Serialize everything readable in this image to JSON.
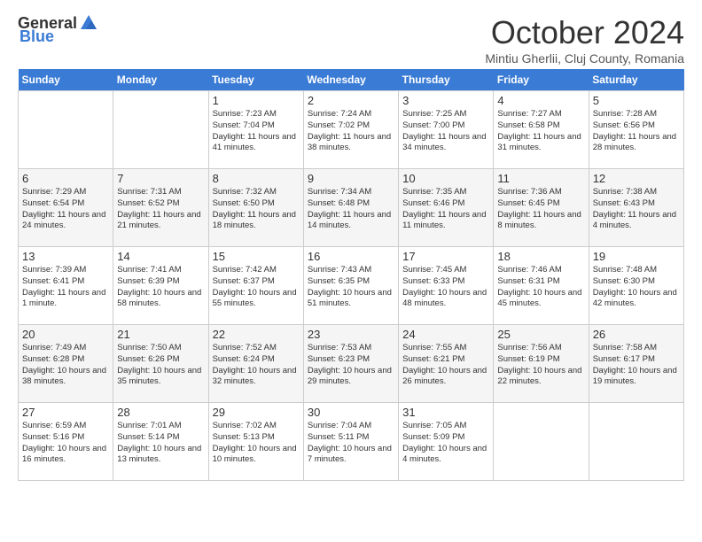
{
  "header": {
    "logo_general": "General",
    "logo_blue": "Blue",
    "month": "October 2024",
    "location": "Mintiu Gherlii, Cluj County, Romania"
  },
  "days_of_week": [
    "Sunday",
    "Monday",
    "Tuesday",
    "Wednesday",
    "Thursday",
    "Friday",
    "Saturday"
  ],
  "weeks": [
    [
      {
        "day": "",
        "info": ""
      },
      {
        "day": "",
        "info": ""
      },
      {
        "day": "1",
        "info": "Sunrise: 7:23 AM\nSunset: 7:04 PM\nDaylight: 11 hours and 41 minutes."
      },
      {
        "day": "2",
        "info": "Sunrise: 7:24 AM\nSunset: 7:02 PM\nDaylight: 11 hours and 38 minutes."
      },
      {
        "day": "3",
        "info": "Sunrise: 7:25 AM\nSunset: 7:00 PM\nDaylight: 11 hours and 34 minutes."
      },
      {
        "day": "4",
        "info": "Sunrise: 7:27 AM\nSunset: 6:58 PM\nDaylight: 11 hours and 31 minutes."
      },
      {
        "day": "5",
        "info": "Sunrise: 7:28 AM\nSunset: 6:56 PM\nDaylight: 11 hours and 28 minutes."
      }
    ],
    [
      {
        "day": "6",
        "info": "Sunrise: 7:29 AM\nSunset: 6:54 PM\nDaylight: 11 hours and 24 minutes."
      },
      {
        "day": "7",
        "info": "Sunrise: 7:31 AM\nSunset: 6:52 PM\nDaylight: 11 hours and 21 minutes."
      },
      {
        "day": "8",
        "info": "Sunrise: 7:32 AM\nSunset: 6:50 PM\nDaylight: 11 hours and 18 minutes."
      },
      {
        "day": "9",
        "info": "Sunrise: 7:34 AM\nSunset: 6:48 PM\nDaylight: 11 hours and 14 minutes."
      },
      {
        "day": "10",
        "info": "Sunrise: 7:35 AM\nSunset: 6:46 PM\nDaylight: 11 hours and 11 minutes."
      },
      {
        "day": "11",
        "info": "Sunrise: 7:36 AM\nSunset: 6:45 PM\nDaylight: 11 hours and 8 minutes."
      },
      {
        "day": "12",
        "info": "Sunrise: 7:38 AM\nSunset: 6:43 PM\nDaylight: 11 hours and 4 minutes."
      }
    ],
    [
      {
        "day": "13",
        "info": "Sunrise: 7:39 AM\nSunset: 6:41 PM\nDaylight: 11 hours and 1 minute."
      },
      {
        "day": "14",
        "info": "Sunrise: 7:41 AM\nSunset: 6:39 PM\nDaylight: 10 hours and 58 minutes."
      },
      {
        "day": "15",
        "info": "Sunrise: 7:42 AM\nSunset: 6:37 PM\nDaylight: 10 hours and 55 minutes."
      },
      {
        "day": "16",
        "info": "Sunrise: 7:43 AM\nSunset: 6:35 PM\nDaylight: 10 hours and 51 minutes."
      },
      {
        "day": "17",
        "info": "Sunrise: 7:45 AM\nSunset: 6:33 PM\nDaylight: 10 hours and 48 minutes."
      },
      {
        "day": "18",
        "info": "Sunrise: 7:46 AM\nSunset: 6:31 PM\nDaylight: 10 hours and 45 minutes."
      },
      {
        "day": "19",
        "info": "Sunrise: 7:48 AM\nSunset: 6:30 PM\nDaylight: 10 hours and 42 minutes."
      }
    ],
    [
      {
        "day": "20",
        "info": "Sunrise: 7:49 AM\nSunset: 6:28 PM\nDaylight: 10 hours and 38 minutes."
      },
      {
        "day": "21",
        "info": "Sunrise: 7:50 AM\nSunset: 6:26 PM\nDaylight: 10 hours and 35 minutes."
      },
      {
        "day": "22",
        "info": "Sunrise: 7:52 AM\nSunset: 6:24 PM\nDaylight: 10 hours and 32 minutes."
      },
      {
        "day": "23",
        "info": "Sunrise: 7:53 AM\nSunset: 6:23 PM\nDaylight: 10 hours and 29 minutes."
      },
      {
        "day": "24",
        "info": "Sunrise: 7:55 AM\nSunset: 6:21 PM\nDaylight: 10 hours and 26 minutes."
      },
      {
        "day": "25",
        "info": "Sunrise: 7:56 AM\nSunset: 6:19 PM\nDaylight: 10 hours and 22 minutes."
      },
      {
        "day": "26",
        "info": "Sunrise: 7:58 AM\nSunset: 6:17 PM\nDaylight: 10 hours and 19 minutes."
      }
    ],
    [
      {
        "day": "27",
        "info": "Sunrise: 6:59 AM\nSunset: 5:16 PM\nDaylight: 10 hours and 16 minutes."
      },
      {
        "day": "28",
        "info": "Sunrise: 7:01 AM\nSunset: 5:14 PM\nDaylight: 10 hours and 13 minutes."
      },
      {
        "day": "29",
        "info": "Sunrise: 7:02 AM\nSunset: 5:13 PM\nDaylight: 10 hours and 10 minutes."
      },
      {
        "day": "30",
        "info": "Sunrise: 7:04 AM\nSunset: 5:11 PM\nDaylight: 10 hours and 7 minutes."
      },
      {
        "day": "31",
        "info": "Sunrise: 7:05 AM\nSunset: 5:09 PM\nDaylight: 10 hours and 4 minutes."
      },
      {
        "day": "",
        "info": ""
      },
      {
        "day": "",
        "info": ""
      }
    ]
  ]
}
